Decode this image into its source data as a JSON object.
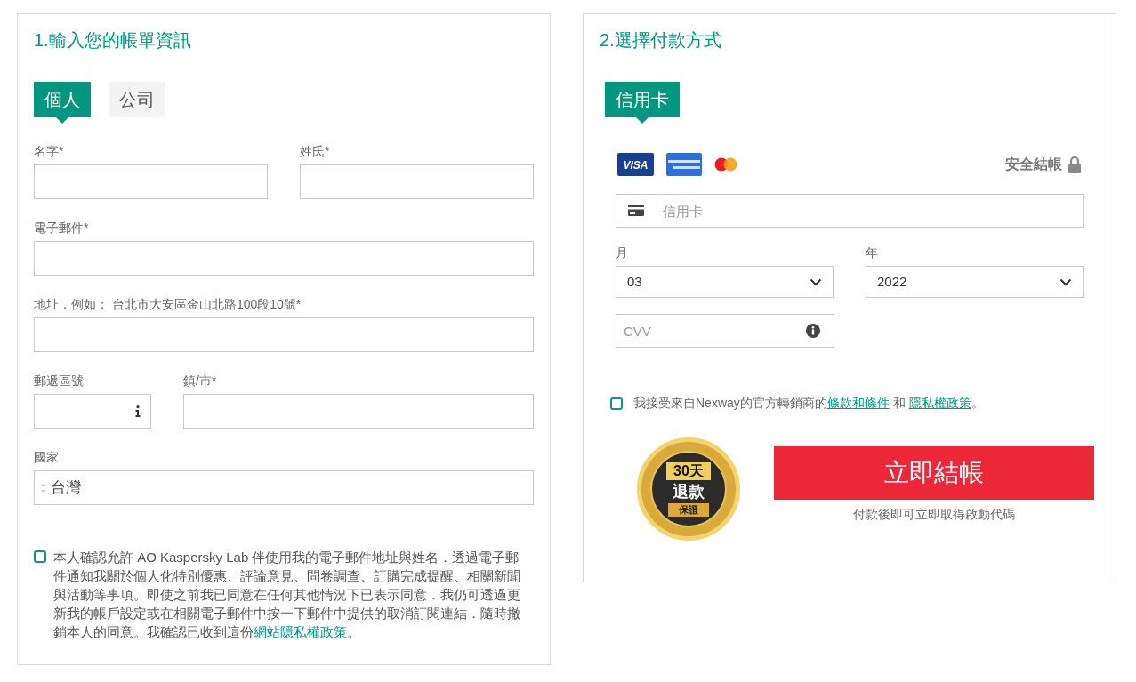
{
  "billing": {
    "title": "1.輸入您的帳單資訊",
    "tabs": [
      {
        "label": "個人",
        "selected": true
      },
      {
        "label": "公司",
        "selected": false
      }
    ],
    "first_name": {
      "label": "名字*"
    },
    "last_name": {
      "label": "姓氏*"
    },
    "email": {
      "label": "電子郵件*"
    },
    "address": {
      "label": "地址．例如： 台北市大安區金山北路100段10號*"
    },
    "postcode": {
      "label": "郵遞區號"
    },
    "city": {
      "label": "鎮/市*"
    },
    "country": {
      "label": "國家",
      "value": "台灣"
    },
    "consent": {
      "checked": false,
      "text": "本人確認允許 AO Kaspersky Lab 伴使用我的電子郵件地址與姓名．透過電子郵件通知我關於個人化特別優惠、評論意見、問卷調查、訂購完成提醒、相關新聞與活動等事項。即使之前我已同意在任何其他情況下已表示同意．我仍可透過更新我的帳戶設定或在相關電子郵件中按一下郵件中提供的取消訂閱連結．隨時撤銷本人的同意。我確認已收到這份",
      "link": "網站隱私權政策",
      "suffix": "。"
    }
  },
  "payment": {
    "title": "2.選擇付款方式",
    "tabs": [
      {
        "label": "信用卡",
        "selected": true
      }
    ],
    "visa_logo": "VISA",
    "secure_label": "安全結帳",
    "card_number": {
      "placeholder": "信用卡"
    },
    "month": {
      "label": "月",
      "value": "03"
    },
    "year": {
      "label": "年",
      "value": "2022"
    },
    "cvv": {
      "placeholder": "CVV"
    },
    "terms": {
      "checked": false,
      "text": "我接受來自Nexway的官方轉銷商的",
      "link_terms": "條款和條件",
      "between": "和",
      "link_privacy": "隱私權政策",
      "suffix": "。"
    },
    "seal": {
      "days": "30天",
      "refund": "退款",
      "guarantee": "保證"
    },
    "checkout_button": "立即結帳",
    "note": "付款後即可立即取得啟動代碼"
  }
}
